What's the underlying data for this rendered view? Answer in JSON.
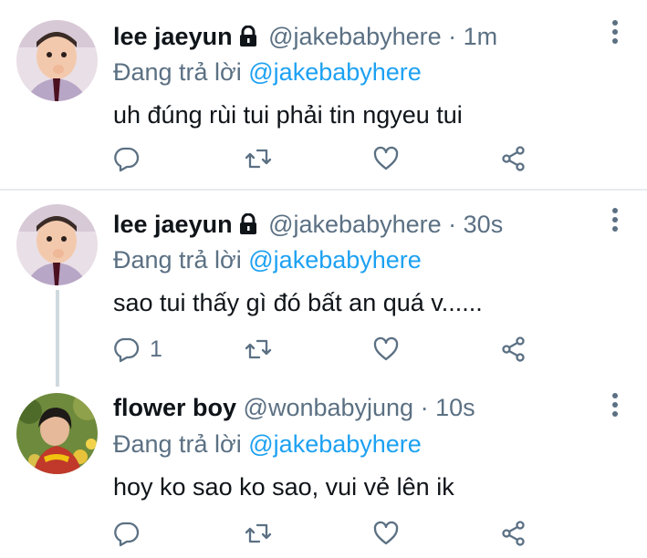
{
  "tweets": [
    {
      "name": "lee jaeyun",
      "handle": "@jakebabyhere",
      "dot": "·",
      "time": "1m",
      "reply_prefix": "Đang trả lời ",
      "reply_to": "@jakebabyhere",
      "text": "uh đúng rùi tui phải tin ngyeu tui",
      "reply_count": "",
      "protected": true
    },
    {
      "name": "lee jaeyun",
      "handle": "@jakebabyhere",
      "dot": "·",
      "time": "30s",
      "reply_prefix": "Đang trả lời ",
      "reply_to": "@jakebabyhere",
      "text": "sao tui thấy gì đó bất an quá v......",
      "reply_count": "1",
      "protected": true
    },
    {
      "name": "flower boy",
      "handle": "@wonbabyjung",
      "dot": "·",
      "time": "10s",
      "reply_prefix": "Đang trả lời ",
      "reply_to": "@jakebabyhere",
      "text": "hoy ko sao ko sao, vui vẻ lên ik",
      "reply_count": "",
      "protected": false
    }
  ],
  "icons": [
    "reply-icon",
    "retweet-icon",
    "like-icon",
    "share-icon",
    "more-icon",
    "lock-icon"
  ],
  "colors": {
    "link": "#1da1f2",
    "muted": "#5b7083",
    "text": "#0f1419",
    "divider": "#e6ecf0"
  }
}
